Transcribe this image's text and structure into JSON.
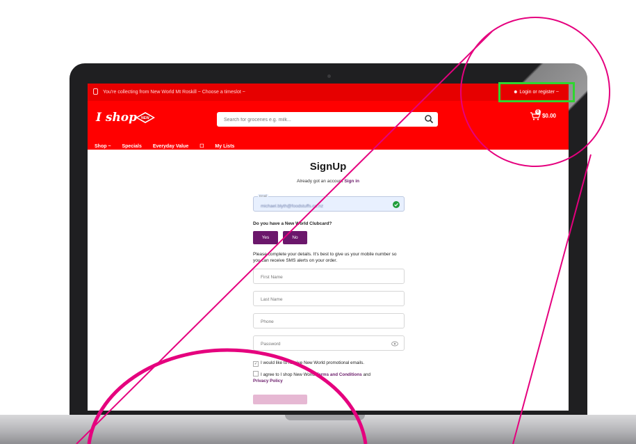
{
  "topbar": {
    "collecting_text": "You're collecting from New World Mt Roskill ~ Choose a timeslot ~",
    "login_label": "Login or register ~"
  },
  "header": {
    "logo_text": "I shop",
    "badge_text": "NEW",
    "search_placeholder": "Search for groceries e.g. milk...",
    "cart_count": "0",
    "cart_total": "$0.00"
  },
  "nav": {
    "items": [
      "Shop ~",
      "Specials",
      "Everyday Value",
      "My Lists"
    ]
  },
  "signup": {
    "title": "SignUp",
    "already_text": "Already got an account",
    "sign_in_link": "Sign in",
    "email_label": "Email",
    "email_value": "michael.blyth@foodstuffs.co.nz",
    "clubcard_question": "Do you have a New World Clubcard?",
    "yes_label": "Yes",
    "no_label": "No",
    "info_text": "Please complete your details. It's best to give us your mobile number so you can receive SMS alerts on your order.",
    "first_name_placeholder": "First Name",
    "last_name_placeholder": "Last Name",
    "phone_placeholder": "Phone",
    "password_placeholder": "Password",
    "promo_checkbox_label": "I would like to receive New World promotional emails.",
    "terms_prefix": "I agree to I shop New World",
    "terms_link": "Terms and Conditions",
    "terms_and": "and",
    "privacy_link": "Privacy Policy"
  },
  "colors": {
    "brand_red": "#e60000",
    "accent_purple": "#6b176b",
    "highlight_green": "#2fd62f",
    "annotation_magenta": "#e5007e"
  }
}
